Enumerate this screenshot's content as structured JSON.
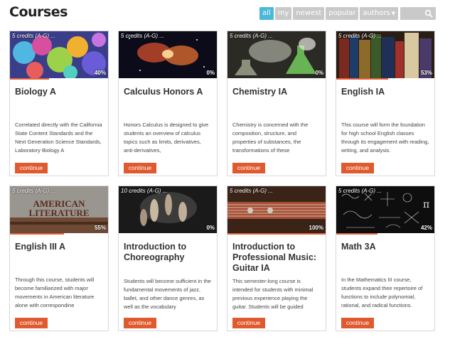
{
  "page_title": "Courses",
  "filters": [
    {
      "label": "all",
      "active": true
    },
    {
      "label": "my",
      "active": false
    },
    {
      "label": "newest",
      "active": false
    },
    {
      "label": "popular",
      "active": false
    },
    {
      "label": "authors",
      "active": false
    }
  ],
  "search": {
    "placeholder": "",
    "value": ""
  },
  "colors": {
    "accent": "#4ab8d9",
    "button": "#e05a2f",
    "progress": "#e8603a",
    "filter_bg": "#c9c9c9"
  },
  "courses": [
    {
      "credits": "5 credits (A-G) ...",
      "percent": "40%",
      "progress": 0.4,
      "title": "Biology A",
      "description": "Correlated directly with the California State Content Standards and the Next Generation Science Standards, Laboratory Biology A",
      "button": "continue",
      "thumb": "biology-molecules-image"
    },
    {
      "credits": "5 credits (A-G) ...",
      "percent": "0%",
      "progress": 0.0,
      "title": "Calculus Honors A",
      "description": "Honors Calculus is designed to give students an overview of calculus topics such as limits, derivatives, anti-derivatives,",
      "button": "continue",
      "thumb": "calculus-nebula-image"
    },
    {
      "credits": "5 credits (A-G) ...",
      "percent": "0%",
      "progress": 0.0,
      "title": "Chemistry IA",
      "description": "Chemistry is concerned with the composition, structure, and properties of substances, the transformations of these",
      "button": "continue",
      "thumb": "chemistry-flasks-image"
    },
    {
      "credits": "5 credits (A-G) ...",
      "percent": "53%",
      "progress": 0.53,
      "title": "English IA",
      "description": "This course will form the foundation for high school English classes through its engagement with reading, writing, and analysis.",
      "button": "continue",
      "thumb": "english-books-image"
    },
    {
      "credits": "5 credits (A-G) ...",
      "percent": "55%",
      "progress": 0.55,
      "title": "English III A",
      "description": "Through this course, students will become familiarized with major movements in American literature alone with correspondine",
      "button": "continue",
      "thumb": "american-literature-image",
      "thumb_text": "AMERICAN LITERATURE"
    },
    {
      "credits": "10 credits (A-G) ...",
      "percent": "0%",
      "progress": 0.0,
      "title": "Introduction to Choreography",
      "description": "Students will become sufficient in the fundamental movements of jazz, ballet, and other dance genres, as well as the vocabulary",
      "button": "continue",
      "thumb": "dancers-image"
    },
    {
      "credits": "5 credits (A-G) ...",
      "percent": "100%",
      "progress": 1.0,
      "title": "Introduction to Professional Music: Guitar IA",
      "description": "This semester-long course is intended for students with minimal previous experience playing the guitar. Students will be guided",
      "button": "continue",
      "thumb": "guitar-image"
    },
    {
      "credits": "5 credits (A-G) ...",
      "percent": "42%",
      "progress": 0.42,
      "title": "Math 3A",
      "description": "In the Mathematics III course, students expand their repertoire of functions to include polynomial, rational, and radical functions.",
      "button": "continue",
      "thumb": "math-formulas-image"
    }
  ]
}
